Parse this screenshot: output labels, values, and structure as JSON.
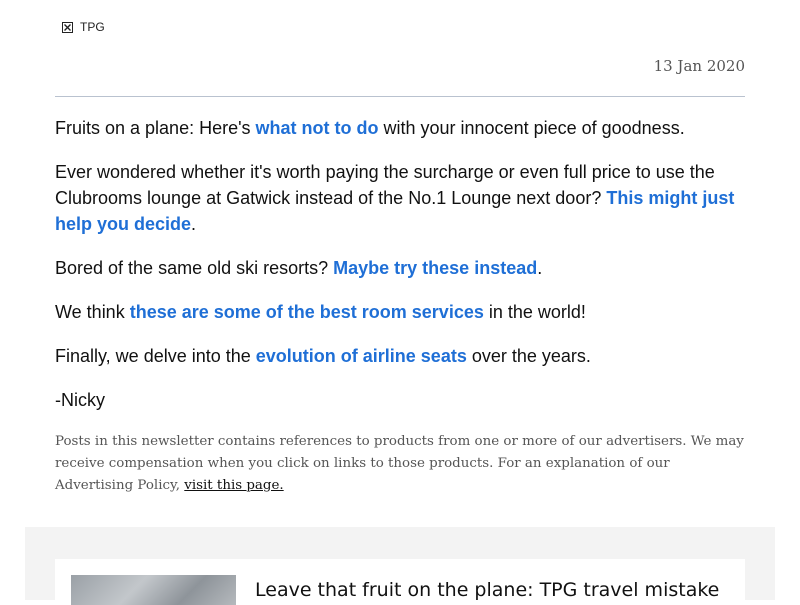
{
  "header": {
    "logo_alt": "TPG",
    "date": "13 Jan 2020"
  },
  "intro": {
    "p1": {
      "before": "Fruits on a plane: Here's ",
      "link": "what not to do",
      "after": " with your innocent piece of goodness."
    },
    "p2": {
      "before": "Ever wondered whether it's worth paying the surcharge or even full price to use the Clubrooms lounge at Gatwick instead of the No.1 Lounge next door? ",
      "link": "This might just help you decide",
      "after": "."
    },
    "p3": {
      "before": "Bored of the same old ski resorts? ",
      "link": "Maybe try these instead",
      "after": "."
    },
    "p4": {
      "before": "We think ",
      "link": "these are some of the best room services",
      "after": " in the world!"
    },
    "p5": {
      "before": "Finally, we delve into the ",
      "link": "evolution of airline seats",
      "after": " over the years."
    },
    "signoff": "-Nicky"
  },
  "disclaimer": {
    "text": "Posts in this newsletter contains references to products from one or more of our advertisers. We may receive compensation when you click on links to those products. For an explanation of our Advertising Policy, ",
    "link": "visit this page."
  },
  "card": {
    "title": "Leave that fruit on the plane: TPG travel mistake"
  },
  "colors": {
    "link": "#1f6fd6",
    "muted": "#555555",
    "band": "#f3f3f3"
  }
}
